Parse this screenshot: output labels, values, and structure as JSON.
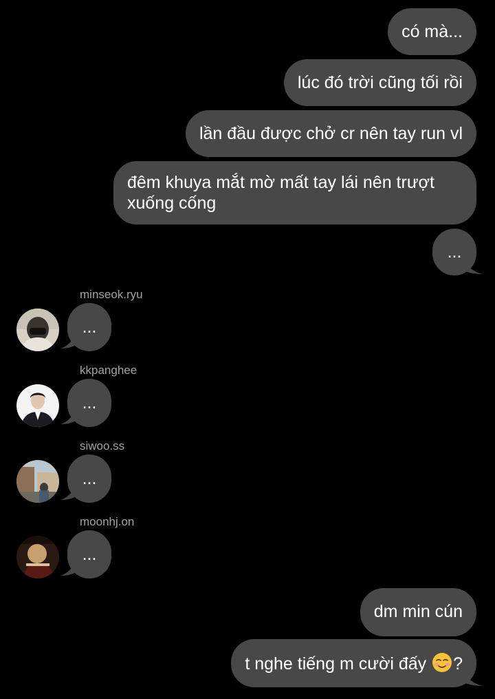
{
  "colors": {
    "background": "#000000",
    "bubble": "#484848",
    "username": "#a3a3a3",
    "text": "#ffffff"
  },
  "sent_messages": [
    {
      "text": "có mà..."
    },
    {
      "text": "lúc đó trời cũng tối rồi"
    },
    {
      "text": "lần đầu được chở cr nên tay run vl"
    },
    {
      "line1": "đêm khuya mắt mờ mất tay lái nên trượt",
      "line2": "xuống cống"
    },
    {
      "text": "..."
    }
  ],
  "received_messages": [
    {
      "username": "minseok.ryu",
      "text": "...",
      "avatar_icon": "avatar-photo-masked-person"
    },
    {
      "username": "kkpanghee",
      "text": "...",
      "avatar_icon": "avatar-photo-suited-person"
    },
    {
      "username": "siwoo.ss",
      "text": "...",
      "avatar_icon": "avatar-photo-street-scene"
    },
    {
      "username": "moonhj.on",
      "text": "...",
      "avatar_icon": "avatar-photo-dark-portrait"
    }
  ],
  "sent_messages_bottom": [
    {
      "text": "dm min cún"
    },
    {
      "text_before_emoji": "t nghe tiếng m cười đấy ",
      "emoji": "smiling-face-icon",
      "text_after_emoji": "?"
    }
  ]
}
